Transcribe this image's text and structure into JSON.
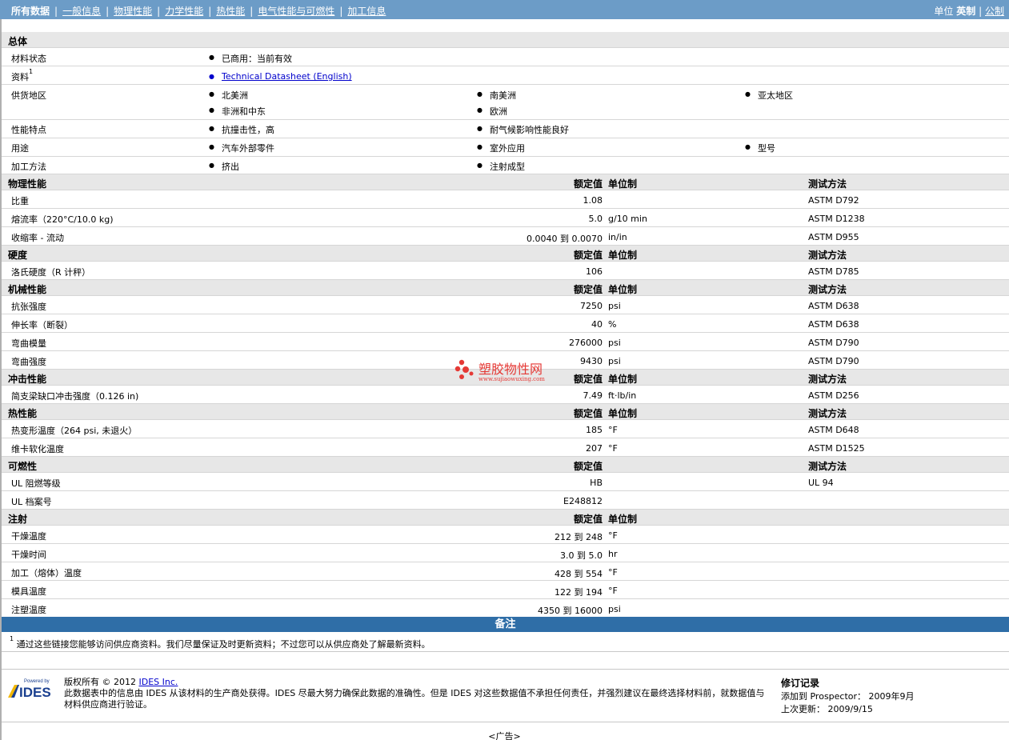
{
  "nav": {
    "items": [
      "所有数据",
      "一般信息",
      "物理性能",
      "力学性能",
      "热性能",
      "电气性能与可燃性",
      "加工信息"
    ],
    "unit_label": "单位",
    "unit_english": "英制",
    "unit_metric": "公制"
  },
  "general": {
    "title": "总体",
    "status_label": "材料状态",
    "status_value": "已商用：当前有效",
    "doc_label": "资料",
    "doc_sup": "1",
    "doc_link": "Technical Datasheet (English)",
    "region_label": "供货地区",
    "regions": [
      "北美洲",
      "南美洲",
      "亚太地区",
      "非洲和中东",
      "欧洲"
    ],
    "features_label": "性能特点",
    "features": [
      "抗撞击性，高",
      "耐气候影响性能良好"
    ],
    "uses_label": "用途",
    "uses": [
      "汽车外部零件",
      "室外应用",
      "型号"
    ],
    "processing_label": "加工方法",
    "processing": [
      "挤出",
      "注射成型"
    ]
  },
  "headers": {
    "rated": "额定值",
    "unit": "单位制",
    "test": "测试方法"
  },
  "physical": {
    "title": "物理性能",
    "rows": [
      {
        "name": "比重",
        "value": "1.08",
        "unit": "",
        "test": "ASTM D792"
      },
      {
        "name": "熔流率（220°C/10.0 kg)",
        "value": "5.0",
        "unit": "g/10 min",
        "test": "ASTM D1238"
      },
      {
        "name": "收缩率 - 流动",
        "value": "0.0040 到  0.0070",
        "unit": "in/in",
        "test": "ASTM D955"
      }
    ]
  },
  "hardness": {
    "title": "硬度",
    "rows": [
      {
        "name": "洛氏硬度（R 计秤）",
        "value": "106",
        "unit": "",
        "test": "ASTM D785"
      }
    ]
  },
  "mechanical": {
    "title": "机械性能",
    "rows": [
      {
        "name": "抗张强度",
        "value": "7250",
        "unit": "psi",
        "test": "ASTM D638"
      },
      {
        "name": "伸长率（断裂）",
        "value": "40",
        "unit": "%",
        "test": "ASTM D638"
      },
      {
        "name": "弯曲模量",
        "value": "276000",
        "unit": "psi",
        "test": "ASTM D790"
      },
      {
        "name": "弯曲强度",
        "value": "9430",
        "unit": "psi",
        "test": "ASTM D790"
      }
    ]
  },
  "impact": {
    "title": "冲击性能",
    "rows": [
      {
        "name": "简支梁缺口冲击强度（0.126 in)",
        "value": "7.49",
        "unit": "ft·lb/in",
        "test": "ASTM D256"
      }
    ]
  },
  "thermal": {
    "title": "热性能",
    "rows": [
      {
        "name": "热变形温度（264 psi, 未退火）",
        "value": "185",
        "unit": "°F",
        "test": "ASTM D648"
      },
      {
        "name": "维卡软化温度",
        "value": "207",
        "unit": "°F",
        "test": "ASTM D1525"
      }
    ]
  },
  "flammability": {
    "title": "可燃性",
    "rows": [
      {
        "name": "UL 阻燃等级",
        "value": "HB",
        "unit": "",
        "test": "UL 94"
      },
      {
        "name": "UL 档案号",
        "value": "E248812",
        "unit": "",
        "test": ""
      }
    ]
  },
  "injection": {
    "title": "注射",
    "rows": [
      {
        "name": "干燥温度",
        "value": "212 到  248",
        "unit": "°F",
        "test": ""
      },
      {
        "name": "干燥时间",
        "value": "3.0 到  5.0",
        "unit": "hr",
        "test": ""
      },
      {
        "name": "加工（熔体）温度",
        "value": "428 到  554",
        "unit": "°F",
        "test": ""
      },
      {
        "name": "模具温度",
        "value": "122 到  194",
        "unit": "°F",
        "test": ""
      },
      {
        "name": "注塑温度",
        "value": "4350 到  16000",
        "unit": "psi",
        "test": ""
      }
    ]
  },
  "notes": {
    "title": "备注",
    "sup": "1",
    "text": "通过这些链接您能够访问供应商资料。我们尽量保证及时更新资料；不过您可以从供应商处了解最新资料。"
  },
  "footer": {
    "powered_by": "Powered by",
    "logo_text": "IDES",
    "copyright_prefix": "版权所有 © 2012",
    "copyright_link": "IDES Inc.",
    "disclaimer": "此数据表中的信息由 IDES 从该材料的生产商处获得。IDES 尽最大努力确保此数据的准确性。但是 IDES 对这些数据值不承担任何责任，并强烈建议在最终选择材料前，就数据值与材料供应商进行验证。",
    "revision_title": "修订记录",
    "added": "添加到 Prospector： 2009年9月",
    "updated": "上次更新： 2009/9/15",
    "ad": "<广告>"
  },
  "watermark": {
    "title": "塑胶物性网",
    "url": "www.sujiaowuxing.com"
  },
  "colors": {
    "topbar": "#6c9cc7",
    "notes_bar": "#2f6ea7",
    "section_bg": "#e7e7e7",
    "watermark": "#e53935"
  }
}
